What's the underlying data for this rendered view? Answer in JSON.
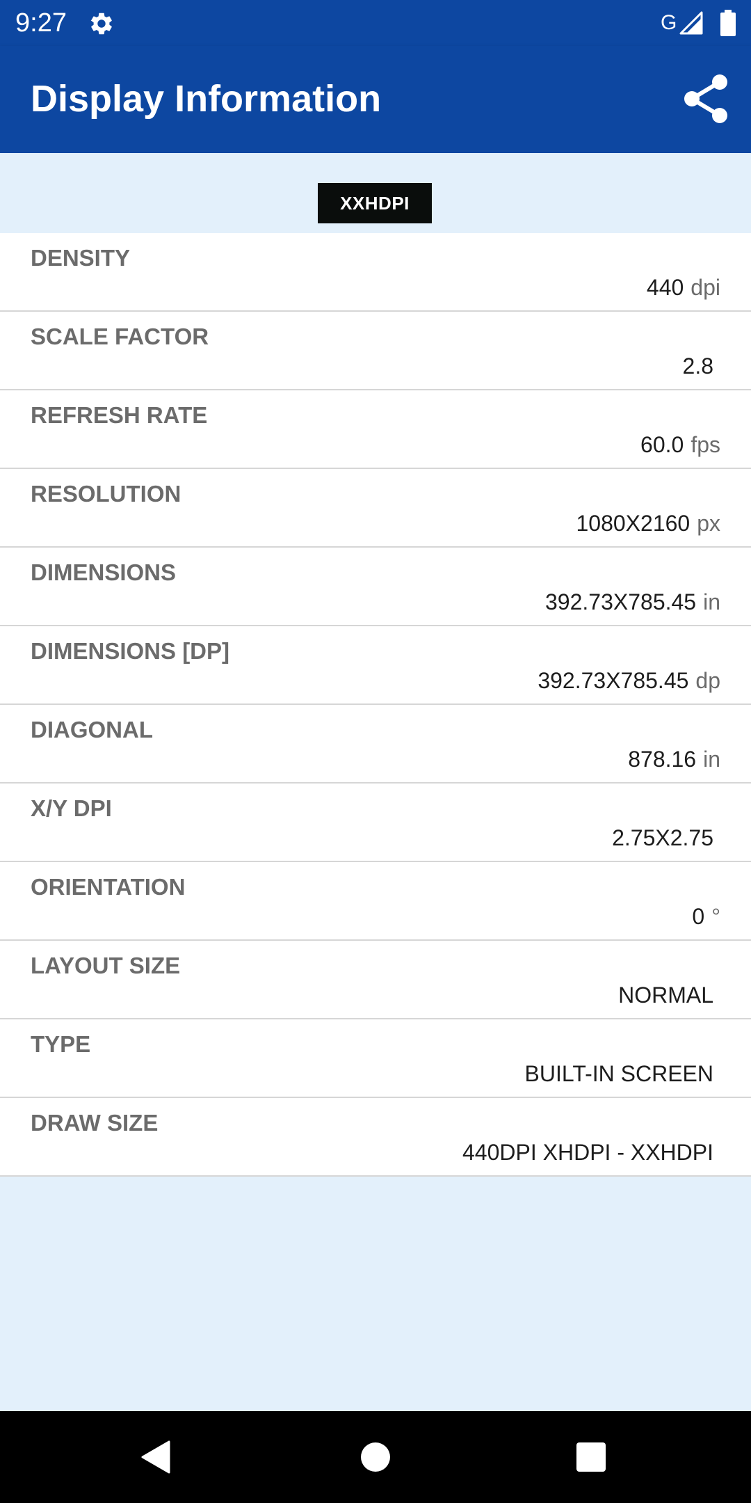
{
  "status_bar": {
    "time": "9:27",
    "network_label": "G",
    "icons": [
      "gear-icon",
      "signal-icon",
      "battery-icon"
    ]
  },
  "app_bar": {
    "title": "Display Information",
    "share_icon": "share-icon"
  },
  "density_badge": "XXHDPI",
  "rows": [
    {
      "label": "DENSITY",
      "value": "440",
      "unit": "dpi"
    },
    {
      "label": "SCALE FACTOR",
      "value": "2.8",
      "unit": ""
    },
    {
      "label": "REFRESH RATE",
      "value": "60.0",
      "unit": "fps"
    },
    {
      "label": "RESOLUTION",
      "value": "1080X2160",
      "unit": "px"
    },
    {
      "label": "DIMENSIONS",
      "value": "392.73X785.45",
      "unit": "in"
    },
    {
      "label": "DIMENSIONS [DP]",
      "value": "392.73X785.45",
      "unit": "dp"
    },
    {
      "label": "DIAGONAL",
      "value": "878.16",
      "unit": "in"
    },
    {
      "label": "X/Y DPI",
      "value": "2.75X2.75",
      "unit": ""
    },
    {
      "label": "ORIENTATION",
      "value": "0",
      "unit": "°"
    },
    {
      "label": "LAYOUT SIZE",
      "value": "NORMAL",
      "unit": ""
    },
    {
      "label": "TYPE",
      "value": "BUILT-IN SCREEN",
      "unit": ""
    },
    {
      "label": "DRAW SIZE",
      "value": "440DPI XHDPI - XXHDPI",
      "unit": ""
    }
  ],
  "nav_bar": {
    "icons": [
      "back-icon",
      "home-icon",
      "recents-icon"
    ]
  },
  "colors": {
    "primary": "#0d47a1",
    "background": "#e3f0fb",
    "badge": "#0a0d0c"
  }
}
